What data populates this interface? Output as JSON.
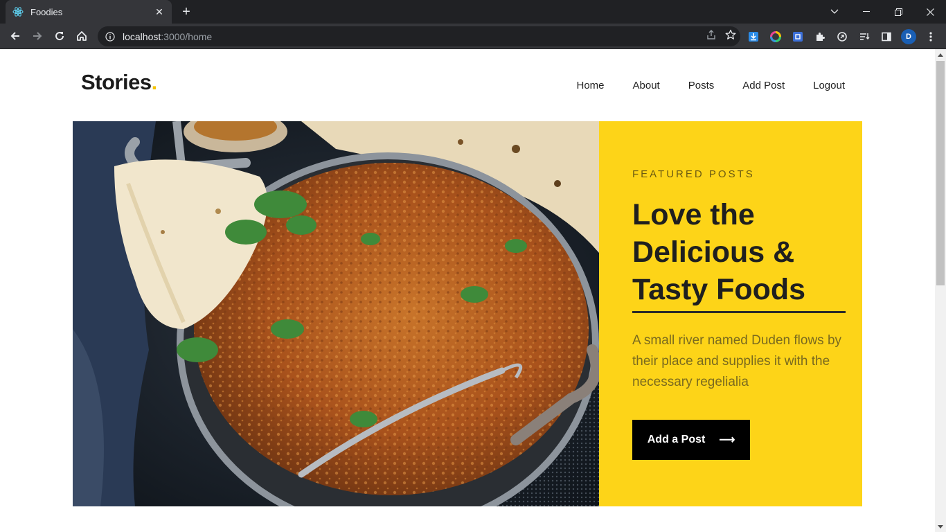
{
  "browser": {
    "tab_title": "Foodies",
    "url_host": "localhost",
    "url_path": ":3000/home",
    "profile_initial": "D"
  },
  "site": {
    "logo_text": "Stories",
    "logo_dot": ".",
    "nav": [
      "Home",
      "About",
      "Posts",
      "Add Post",
      "Logout"
    ]
  },
  "hero": {
    "eyebrow": "FEATURED POSTS",
    "headline": "Love the Delicious & Tasty Foods",
    "description": "A small river named Duden flows by their place and supplies it with the necessary regelialia",
    "cta_label": "Add a Post",
    "cta_arrow": "⟶"
  },
  "colors": {
    "accent_yellow": "#fdd418",
    "logo_dot": "#f5c300",
    "button": "#000000"
  }
}
